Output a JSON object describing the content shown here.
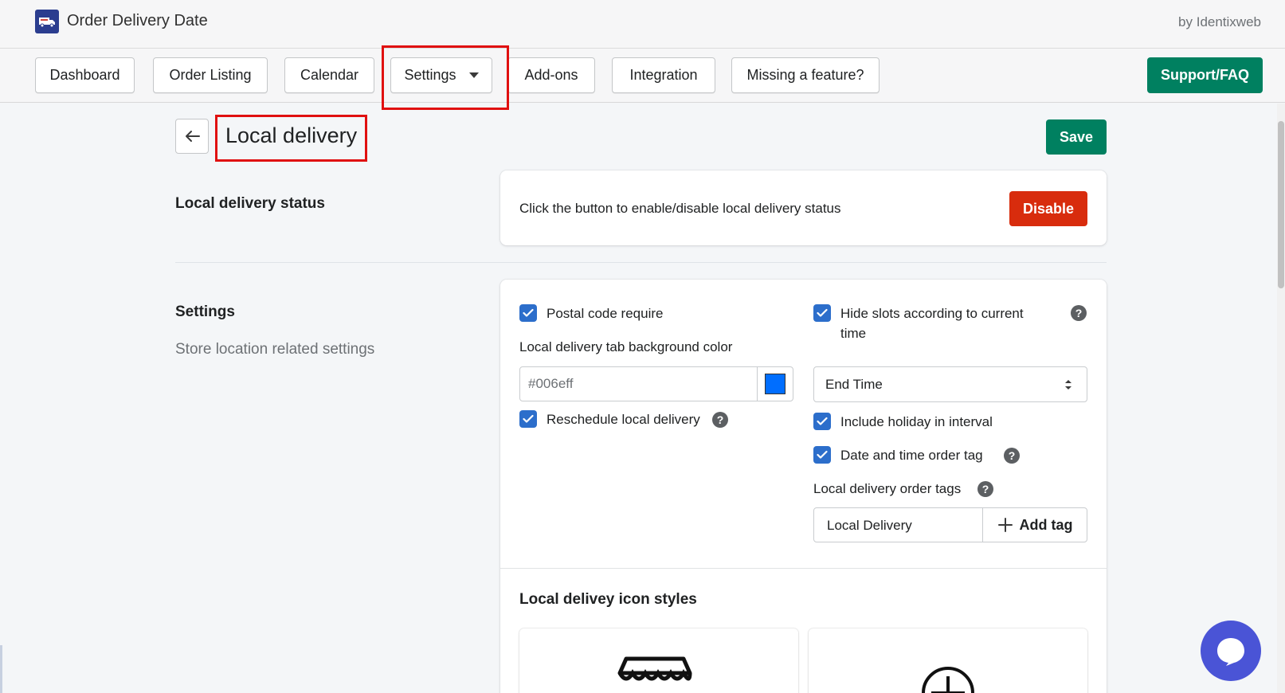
{
  "app": {
    "title": "Order Delivery Date",
    "by": "by Identixweb",
    "logo_icon": "delivery-truck-icon"
  },
  "nav": {
    "tabs": [
      {
        "label": "Dashboard"
      },
      {
        "label": "Order Listing"
      },
      {
        "label": "Calendar"
      },
      {
        "label": "Settings",
        "dropdown": true
      },
      {
        "label": "Add-ons"
      },
      {
        "label": "Integration"
      },
      {
        "label": "Missing a feature?"
      }
    ],
    "support_label": "Support/FAQ"
  },
  "page": {
    "title": "Local delivery",
    "save_label": "Save",
    "back_icon": "arrow-left-icon"
  },
  "status_section": {
    "title": "Local delivery status",
    "description": "Click the button to enable/disable local delivery status",
    "disable_label": "Disable"
  },
  "settings_section": {
    "title": "Settings",
    "subtitle": "Store location related settings",
    "postal_code_label": "Postal code require",
    "postal_code_checked": true,
    "bg_color_label": "Local delivery tab background color",
    "bg_color_value": "#006eff",
    "reschedule_label": "Reschedule local delivery",
    "reschedule_checked": true,
    "hide_slots_label": "Hide slots according to current",
    "hide_slots_label_2": "time",
    "hide_slots_checked": true,
    "slot_select_value": "End Time",
    "include_holiday_label": "Include holiday in interval",
    "include_holiday_checked": true,
    "date_time_tag_label": "Date and time order tag",
    "date_time_tag_checked": true,
    "order_tags_label": "Local delivery order tags",
    "order_tag_value": "Local Delivery",
    "add_tag_label": "Add tag"
  },
  "icon_styles": {
    "title": "Local delivey icon styles",
    "icons": [
      "storefront-awning-icon",
      "plus-circle-icon"
    ]
  },
  "colors": {
    "primary": "#008060",
    "critical": "#d82c0d",
    "checkbox": "#2c6ecb",
    "highlight": "#e01010",
    "chat": "#4a54d6"
  }
}
